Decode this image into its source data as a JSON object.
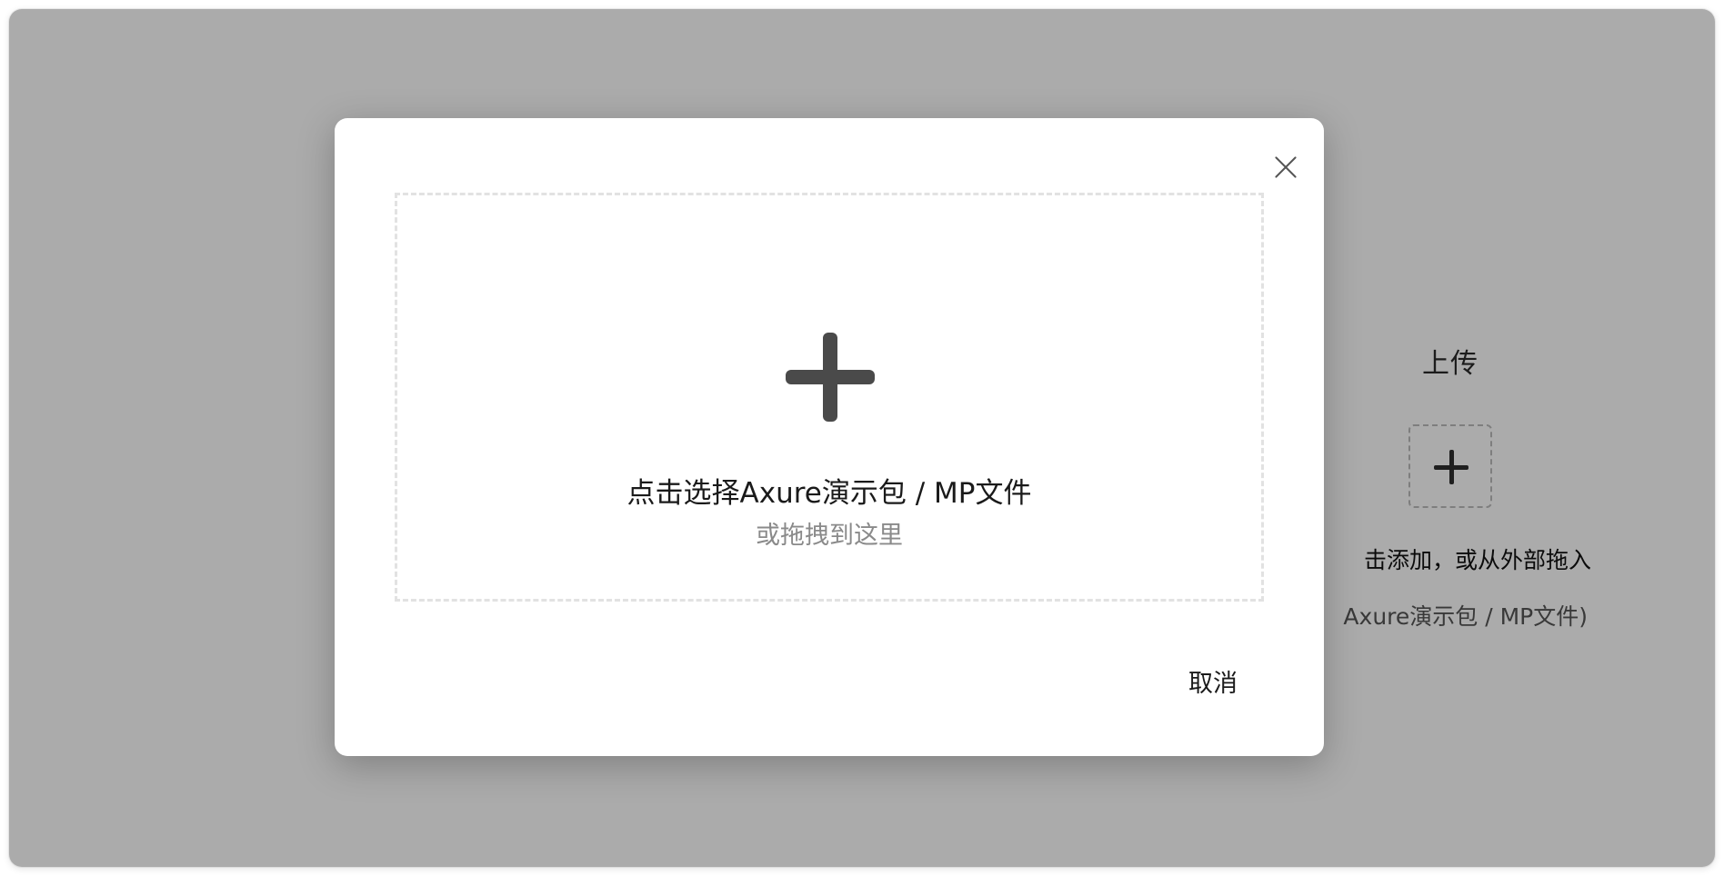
{
  "background": {
    "upload_title": "上传",
    "add_icon": "plus-icon",
    "hint_line1": "击添加，或从外部拖入",
    "hint_line2": "Axure演示包 / MP文件)"
  },
  "modal": {
    "close_icon": "close-icon",
    "dropzone": {
      "plus_icon": "plus-icon",
      "primary_text": "点击选择Axure演示包 / MP文件",
      "secondary_text": "或拖拽到这里"
    },
    "cancel_label": "取消"
  },
  "colors": {
    "overlay": "#000000",
    "modal_bg": "#ffffff",
    "dropzone_border": "#e2e2e2",
    "plus": "#4a4a4a"
  }
}
